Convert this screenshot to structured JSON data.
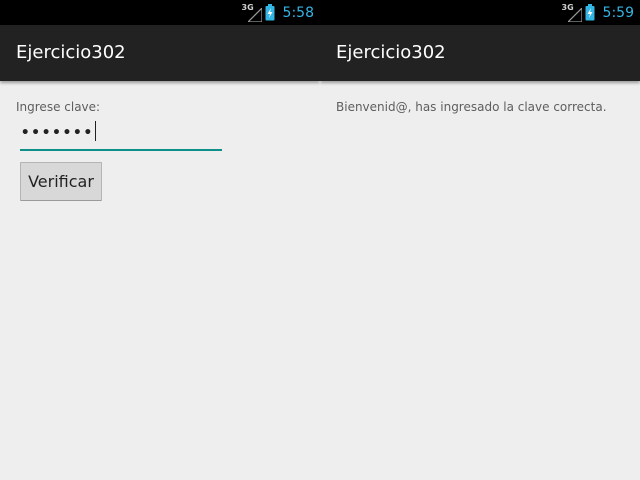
{
  "screens": [
    {
      "status_bar": {
        "network": "3G",
        "time": "5:58"
      },
      "action_bar": {
        "title": "Ejercicio302"
      },
      "form": {
        "prompt_label": "Ingrese clave:",
        "password_value": "•••••••",
        "verify_button": "Verificar"
      }
    },
    {
      "status_bar": {
        "network": "3G",
        "time": "5:59"
      },
      "action_bar": {
        "title": "Ejercicio302"
      },
      "message": "Bienvenid@, has ingresado la clave correcta."
    }
  ],
  "colors": {
    "status_bar_bg": "#000000",
    "clock": "#33b5e5",
    "action_bar_bg": "#222222",
    "screen_bg": "#eeeeee",
    "field_underline": "#0d8f8a",
    "button_bg": "#d8d8d8"
  },
  "icons": {
    "signal": "signal-3g-icon",
    "battery": "battery-charging-icon"
  }
}
